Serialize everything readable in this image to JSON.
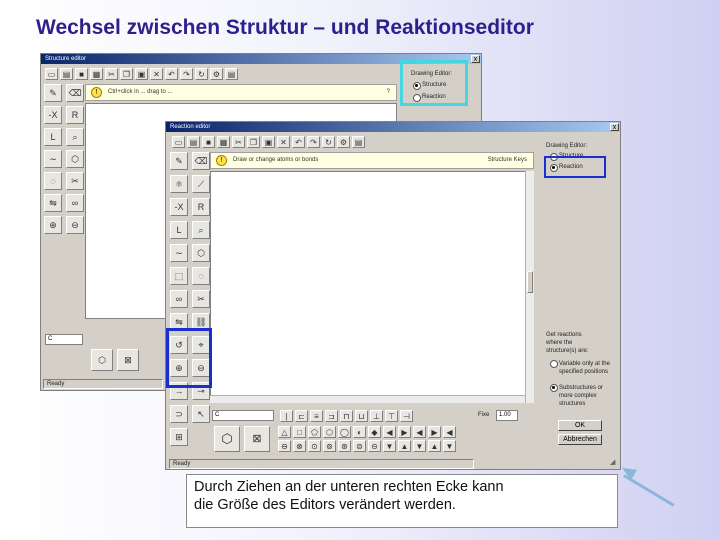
{
  "slide": {
    "title": "Wechsel zwischen Struktur – und Reaktionseditor",
    "caption_line1": "Durch Ziehen an der unteren rechten Ecke kann",
    "caption_line2": "die Größe des Editors verändert werden."
  },
  "structure_editor": {
    "title": "Structure editor",
    "close_glyph": "x",
    "info_text": "Ctrl+click in ... drag to ...",
    "info_right": "?",
    "drawing_editor_label": "Drawing Editor:",
    "options": [
      {
        "label": "Structure",
        "selected": true
      },
      {
        "label": "Reaction",
        "selected": false
      }
    ],
    "input_value": "C",
    "status": "Ready"
  },
  "reaction_editor": {
    "title": "Reaction editor",
    "close_glyph": "x",
    "info_text": "Draw or change atoms or bonds",
    "info_right": "Structure Keys",
    "drawing_editor_label": "Drawing Editor:",
    "options": [
      {
        "label": "Structure",
        "selected": false
      },
      {
        "label": "Reaction",
        "selected": true
      }
    ],
    "reactions_question_l1": "Get reactions",
    "reactions_question_l2": "where the",
    "reactions_question_l3": "structure(s) are:",
    "match_options": [
      {
        "label": "Variable only at the specified positions",
        "selected": false
      },
      {
        "label": "Substructures or more complex structures",
        "selected": true
      }
    ],
    "input_value": "C",
    "zoom_label": "Fixe",
    "zoom_value": "1.00",
    "ok_label": "OK",
    "cancel_label": "Abbrechen",
    "status": "Ready"
  },
  "colors": {
    "title": "#2e1f8c",
    "cyan_highlight": "#44d7e0",
    "blue_highlight": "#1a2fd0",
    "arrow": "#8ab8d8"
  }
}
